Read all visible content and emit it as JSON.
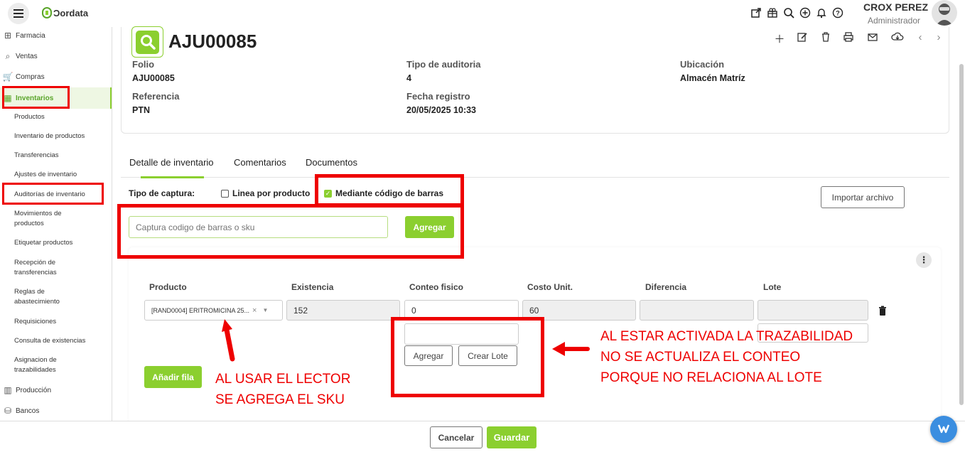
{
  "app": {
    "logo_text": "Ɔordata"
  },
  "user": {
    "name": "CROX PEREZ",
    "role": "Administrador"
  },
  "sidebar": {
    "modules": [
      {
        "label": "Farmacia"
      },
      {
        "label": "Ventas"
      },
      {
        "label": "Compras"
      },
      {
        "label": "Inventarios"
      },
      {
        "label": "Producción"
      },
      {
        "label": "Bancos"
      }
    ],
    "inventory_items": [
      {
        "label": "Productos"
      },
      {
        "label": "Inventario de productos"
      },
      {
        "label": "Transferencias"
      },
      {
        "label": "Ajustes de inventario"
      },
      {
        "label": "Auditorías de inventario"
      },
      {
        "label": "Movimientos de productos"
      },
      {
        "label": "Etiquetar productos"
      },
      {
        "label": "Recepción de transferencias"
      },
      {
        "label": "Reglas de abastecimiento"
      },
      {
        "label": "Requisiciones"
      },
      {
        "label": "Consulta de existencias"
      },
      {
        "label": "Asignacion de trazabilidades"
      }
    ]
  },
  "document": {
    "title": "AJU00085",
    "fields": {
      "folio_label": "Folio",
      "folio": "AJU00085",
      "tipo_label": "Tipo de auditoria",
      "tipo": "4",
      "ubicacion_label": "Ubicación",
      "ubicacion": "Almacén Matríz",
      "referencia_label": "Referencia",
      "referencia": "PTN",
      "fecha_label": "Fecha registro",
      "fecha": "20/05/2025 10:33"
    }
  },
  "tabs": [
    {
      "label": "Detalle de inventario",
      "active": true
    },
    {
      "label": "Comentarios"
    },
    {
      "label": "Documentos"
    }
  ],
  "capture": {
    "label": "Tipo de captura:",
    "option_line": "Linea por producto",
    "option_barcode": "Mediante código de barras",
    "barcode_checked": true,
    "import_button": "Importar archivo",
    "input_placeholder": "Captura codigo de barras o sku",
    "add_button": "Agregar"
  },
  "table": {
    "headers": [
      "Producto",
      "Existencia",
      "Conteo fisico",
      "Costo Unit.",
      "Diferencia",
      "Lote"
    ],
    "row": {
      "producto": "[RAND0004] ERITROMICINA 25...",
      "existencia": "152",
      "conteo": "0",
      "costo": "60",
      "diferencia": "",
      "lote": ""
    },
    "lot_add_button": "Agregar",
    "lot_create_button": "Crear Lote",
    "add_row_button": "Añadir fila"
  },
  "annotations": {
    "sku_note_line1": "AL USAR EL LECTOR",
    "sku_note_line2": "SE AGREGA EL SKU",
    "trace_note_line1": "AL ESTAR ACTIVADA LA TRAZABILIDAD",
    "trace_note_line2": "NO SE ACTUALIZA EL CONTEO",
    "trace_note_line3": "PORQUE NO RELACIONA AL LOTE",
    "color": "#e00000"
  },
  "footer": {
    "cancel": "Cancelar",
    "save": "Guardar"
  },
  "colors": {
    "accent": "#8bcf2f",
    "annotation": "#e00000"
  }
}
